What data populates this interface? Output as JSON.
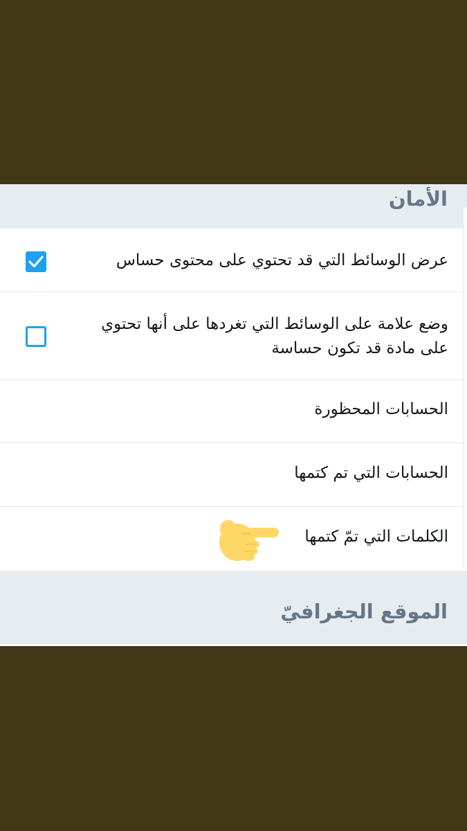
{
  "security": {
    "title": "الأمان",
    "items": [
      {
        "label": "عرض الوسائط التي قد تحتوي على محتوى حساس",
        "checked": true
      },
      {
        "label_line1": "وضع علامة على الوسائط التي تغردها على أنها تحتوي",
        "label_line2": "على مادة قد تكون حساسة",
        "checked": false
      },
      {
        "label": "الحسابات المحظورة"
      },
      {
        "label": "الحسابات التي تم كتمها"
      },
      {
        "label": "الكلمات التي تمّ كتمها"
      }
    ]
  },
  "location": {
    "title": "الموقع الجغرافيّ"
  },
  "colors": {
    "background": "#413717",
    "accent": "#1da1f2",
    "header_bg": "#e6ecf0",
    "header_text": "#657786",
    "emoji": "#ffd766"
  },
  "icons": {
    "checked": "checkbox-checked-icon",
    "unchecked": "checkbox-unchecked-icon",
    "pointer": "pointing-hand-emoji"
  }
}
